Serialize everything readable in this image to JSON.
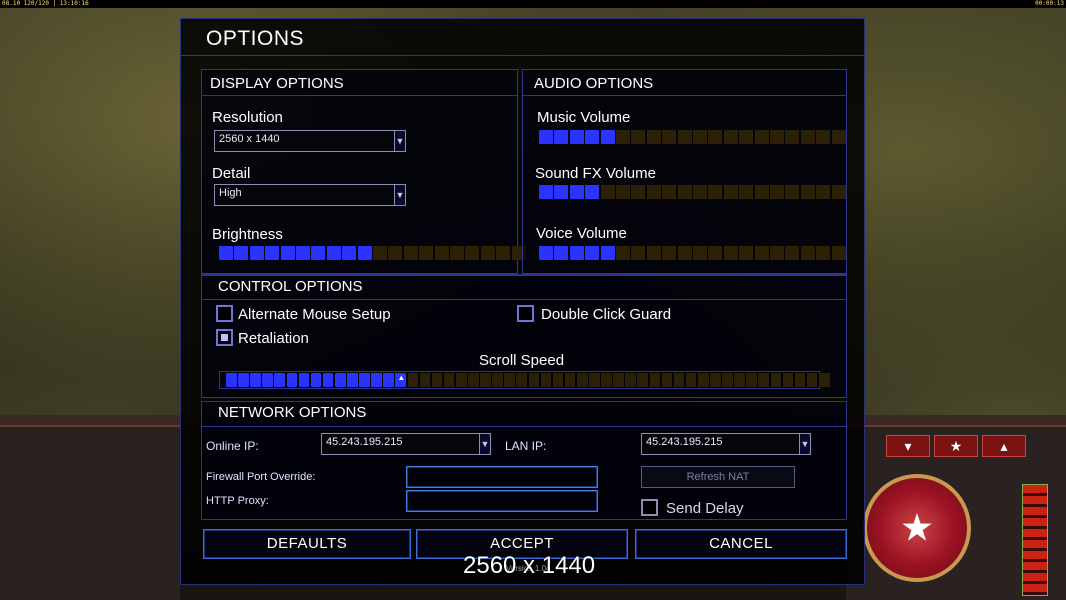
{
  "topbar": {
    "left": "08.10 120/120 | 13:10:16",
    "right": "00:00:13"
  },
  "title": "OPTIONS",
  "display": {
    "title": "DISPLAY OPTIONS",
    "resolution_label": "Resolution",
    "resolution_value": "2560 x 1440",
    "detail_label": "Detail",
    "detail_value": "High",
    "brightness_label": "Brightness",
    "brightness_level": 10,
    "brightness_max": 20
  },
  "audio": {
    "title": "AUDIO OPTIONS",
    "music_label": "Music Volume",
    "music_level": 5,
    "sfx_label": "Sound FX Volume",
    "sfx_level": 4,
    "voice_label": "Voice Volume",
    "voice_level": 5,
    "max": 20
  },
  "control": {
    "title": "CONTROL OPTIONS",
    "alt_mouse_label": "Alternate Mouse Setup",
    "alt_mouse_checked": false,
    "double_click_label": "Double Click Guard",
    "double_click_checked": false,
    "retaliation_label": "Retaliation",
    "retaliation_checked": true,
    "scroll_label": "Scroll Speed",
    "scroll_level": 15,
    "scroll_max": 50
  },
  "network": {
    "title": "NETWORK OPTIONS",
    "online_ip_label": "Online IP:",
    "online_ip_value": "45.243.195.215",
    "lan_ip_label": "LAN IP:",
    "lan_ip_value": "45.243.195.215",
    "firewall_label": "Firewall Port Override:",
    "firewall_value": "",
    "http_proxy_label": "HTTP Proxy:",
    "http_proxy_value": "",
    "refresh_nat_label": "Refresh NAT",
    "send_delay_label": "Send Delay",
    "send_delay_checked": false
  },
  "buttons": {
    "defaults": "DEFAULTS",
    "accept": "ACCEPT",
    "cancel": "CANCEL"
  },
  "version": "Version 1.04",
  "resolution_overlay": "2560 x 1440",
  "colors": {
    "on": "#2a33ff",
    "off": "#2c2106",
    "accent": "#2f3490"
  }
}
